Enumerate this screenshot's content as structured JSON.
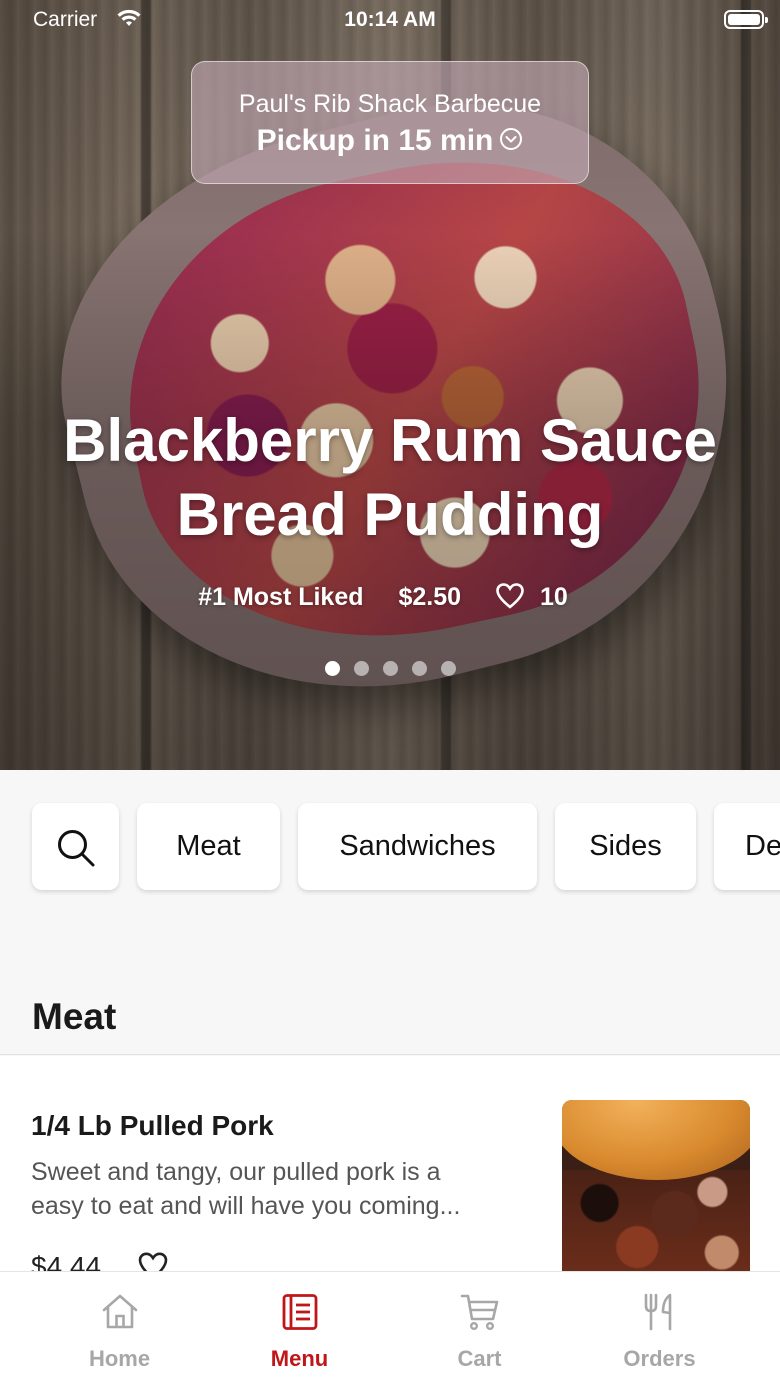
{
  "status_bar": {
    "carrier": "Carrier",
    "time": "10:14 AM"
  },
  "pickup": {
    "restaurant": "Paul's Rib Shack Barbecue",
    "label": "Pickup in 15 min"
  },
  "featured": {
    "title_line1": "Blackberry Rum Sauce",
    "title_line2": "Bread Pudding",
    "rank": "#1 Most Liked",
    "price": "$2.50",
    "likes": "10",
    "slides": 5,
    "active_slide": 1
  },
  "categories": {
    "items": [
      "Meat",
      "Sandwiches",
      "Sides",
      "De"
    ],
    "search_icon": "search-icon"
  },
  "section": {
    "title": "Meat",
    "items": [
      {
        "name": "1/4 Lb Pulled Pork",
        "description_line1": "Sweet and tangy, our pulled pork is a",
        "description_line2": "easy to eat and will have you coming...",
        "price": "$4.44"
      }
    ]
  },
  "tab_bar": {
    "tabs": [
      {
        "label": "Home",
        "icon": "home-icon"
      },
      {
        "label": "Menu",
        "icon": "menu-icon"
      },
      {
        "label": "Cart",
        "icon": "cart-icon"
      },
      {
        "label": "Orders",
        "icon": "utensils-icon"
      }
    ],
    "active": "Menu",
    "accent_color": "#c0161a",
    "inactive_color": "#a7a7a7"
  }
}
